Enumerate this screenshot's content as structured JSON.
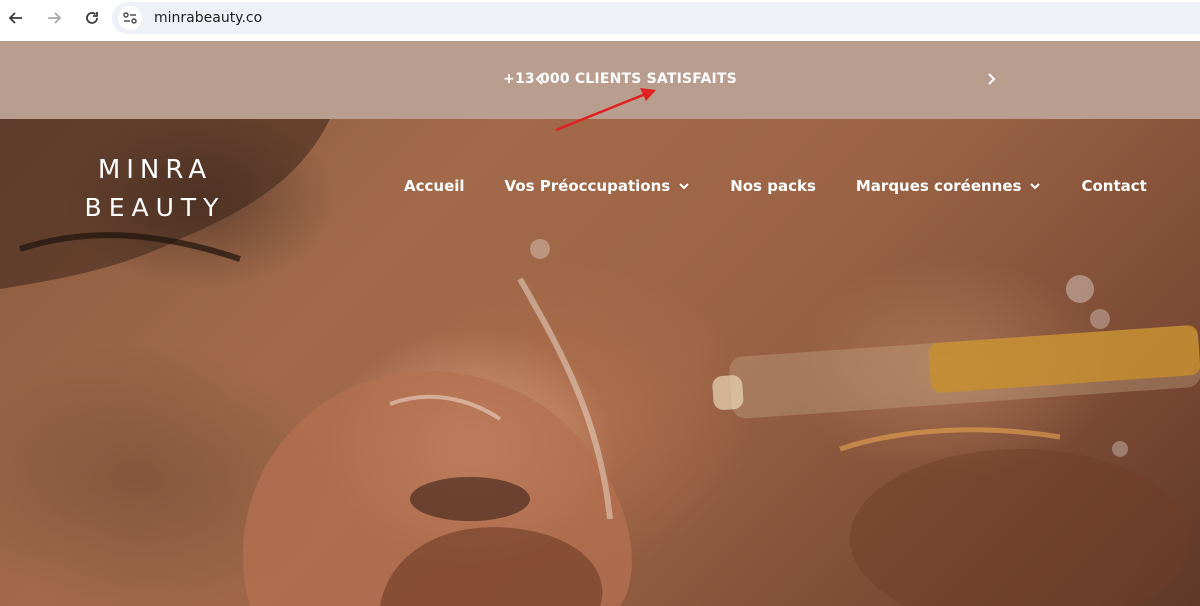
{
  "browser": {
    "url": "minrabeauty.co",
    "icons": [
      "back-arrow-icon",
      "forward-arrow-icon",
      "reload-icon",
      "site-info-icon"
    ]
  },
  "announcement": {
    "text": "+13 000 CLIENTS SATISFAITS",
    "background": "#b99d8f"
  },
  "logo": {
    "line1": "MINRA",
    "line2": "BEAUTY"
  },
  "nav": {
    "items": [
      {
        "label": "Accueil",
        "dropdown": false
      },
      {
        "label": "Vos Préoccupations",
        "dropdown": true
      },
      {
        "label": "Nos packs",
        "dropdown": false
      },
      {
        "label": "Marques coréennes",
        "dropdown": true
      },
      {
        "label": "Contact",
        "dropdown": false
      }
    ]
  },
  "annotation": {
    "color": "#e02020"
  }
}
